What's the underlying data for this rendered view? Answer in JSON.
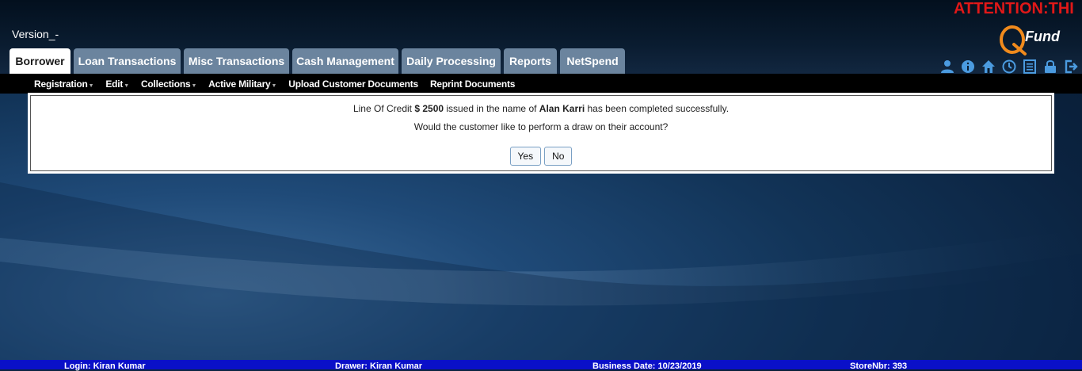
{
  "header": {
    "attention": "ATTENTION:THI",
    "version": "Version_-",
    "logo_text": "Fund"
  },
  "tabs": [
    {
      "label": "Borrower",
      "active": true
    },
    {
      "label": "Loan Transactions"
    },
    {
      "label": "Misc Transactions"
    },
    {
      "label": "Cash Management"
    },
    {
      "label": "Daily Processing"
    },
    {
      "label": "Reports"
    },
    {
      "label": "NetSpend"
    }
  ],
  "toolbar_icons": [
    "user-icon",
    "info-icon",
    "home-icon",
    "clock-icon",
    "list-icon",
    "lock-icon",
    "logout-icon"
  ],
  "menu": [
    {
      "label": "Registration",
      "dropdown": true
    },
    {
      "label": "Edit",
      "dropdown": true
    },
    {
      "label": "Collections",
      "dropdown": true
    },
    {
      "label": "Active Military",
      "dropdown": true
    },
    {
      "label": "Upload Customer Documents"
    },
    {
      "label": "Reprint Documents"
    }
  ],
  "dialog": {
    "prefix": "Line Of Credit ",
    "amount": "$ 2500",
    "middle": " issued in the name of ",
    "customer": "Alan Karri",
    "suffix": " has been completed successfully.",
    "question": "Would the customer like to perform a draw on their account?",
    "yes_label": "Yes",
    "no_label": "No"
  },
  "footer": {
    "login": "Login: Kiran Kumar",
    "drawer": "Drawer: Kiran Kumar",
    "business_date": "Business Date: 10/23/2019",
    "store": "StoreNbr: 393"
  }
}
